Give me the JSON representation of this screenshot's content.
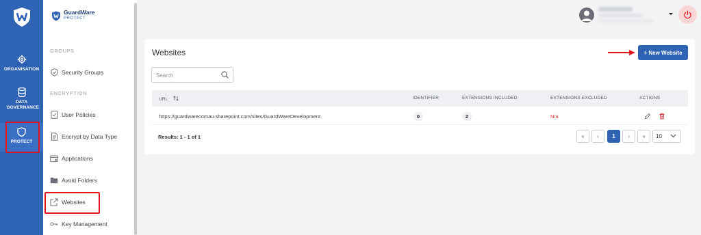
{
  "rail": {
    "items": [
      {
        "label": "ORGANISATION",
        "icon": "gear-icon"
      },
      {
        "label": "DATA GOVERNANCE",
        "icon": "database-icon"
      },
      {
        "label": "PROTECT",
        "icon": "shield-icon"
      }
    ]
  },
  "brand": {
    "name": "GuardWare",
    "sub": "PROTECT"
  },
  "sidebar": {
    "sections": [
      {
        "title": "GROUPS",
        "items": [
          {
            "label": "Security Groups",
            "icon": "shield-check-icon"
          }
        ]
      },
      {
        "title": "ENCRYPTION",
        "items": [
          {
            "label": "User Policies",
            "icon": "policy-check-icon"
          },
          {
            "label": "Encrypt by Data Type",
            "icon": "file-type-icon"
          },
          {
            "label": "Applications",
            "icon": "application-icon"
          },
          {
            "label": "Avoid Folders",
            "icon": "folder-icon"
          },
          {
            "label": "Websites",
            "icon": "external-link-icon"
          },
          {
            "label": "Key Management",
            "icon": "key-icon"
          }
        ]
      }
    ]
  },
  "page": {
    "title": "Websites",
    "new_button": "+ New Website",
    "search_placeholder": "Search"
  },
  "table": {
    "columns": {
      "url": "URL",
      "identifier": "IDENTIFIER",
      "ext_included": "EXTENSIONS INCLUDED",
      "ext_excluded": "EXTENSIONS EXCLUDED",
      "actions": "ACTIONS"
    },
    "rows": [
      {
        "url": "https://guardwarecomau.sharepoint.com/sites/GuardWareDevelopment",
        "identifier": "0",
        "ext_included": "2",
        "ext_excluded": "N/a"
      }
    ]
  },
  "pagination": {
    "results": "Results: 1 - 1 of 1",
    "first": "«",
    "prev": "‹",
    "page": "1",
    "next": "›",
    "last": "»",
    "page_size": "10"
  },
  "colors": {
    "primary": "#2f63b4",
    "highlight": "#e0141c",
    "danger": "#d23b3b"
  }
}
